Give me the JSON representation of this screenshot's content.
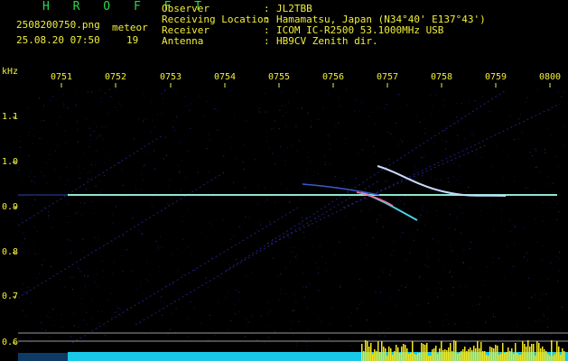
{
  "header": {
    "app_title": "H R O F F T",
    "file_name": "2508200750.png",
    "datetime": "25.08.20 07:50",
    "meteor_label": "meteor",
    "meteor_count": "19"
  },
  "info": [
    {
      "label": "Observer",
      "value": "JL2TBB"
    },
    {
      "label": "Receiving Location",
      "value": "Hamamatsu, Japan (N34°40' E137°43')"
    },
    {
      "label": "Receiver",
      "value": "ICOM IC-R2500 53.1000MHz USB"
    },
    {
      "label": "Antenna",
      "value": "HB9CV Zenith dir."
    }
  ],
  "colon": ":",
  "axis": {
    "y_unit": "kHz",
    "time_ticks": [
      "0751",
      "0752",
      "0753",
      "0754",
      "0755",
      "0756",
      "0757",
      "0758",
      "0759",
      "0800"
    ],
    "freq_ticks": [
      "1.1",
      "1.0",
      "0.9",
      "0.8",
      "0.7",
      "0.6"
    ]
  },
  "colors": {
    "text_green": "#29d84a",
    "text_yellow": "#f2ef3a",
    "carrier": "#8be8d0",
    "level_cyan": "#19c7e6",
    "level_yellow": "#f5e61a",
    "echo": "#3b3bd9"
  }
}
